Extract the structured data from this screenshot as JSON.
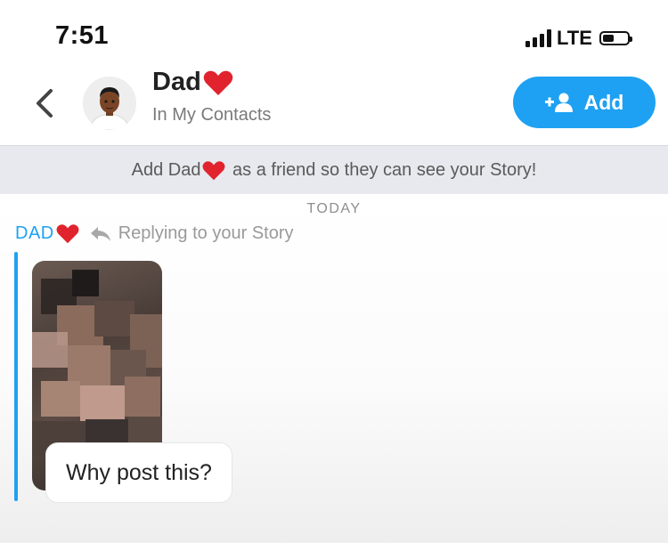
{
  "status_bar": {
    "time": "7:51",
    "network": "LTE",
    "battery_level": 0.45
  },
  "header": {
    "contact_name": "Dad",
    "contact_subtitle": "In My Contacts",
    "add_label": "Add",
    "accent_color": "#1ea1f2",
    "heart_color": "#e0232d"
  },
  "banner": {
    "before": "Add Dad",
    "after": " as a friend so they can see your Story!"
  },
  "chat": {
    "date_label": "TODAY",
    "sender": "DAD",
    "reply_context": "Replying to your Story",
    "message": "Why post this?"
  },
  "icons": {
    "back": "chevron-left-icon",
    "add": "add-friend-icon",
    "reply": "reply-arrow-icon",
    "heart": "heart-icon"
  }
}
